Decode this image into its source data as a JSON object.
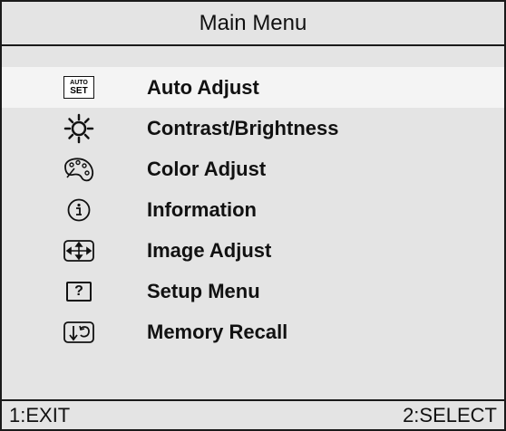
{
  "title": "Main Menu",
  "menu": {
    "items": [
      {
        "label": "Auto Adjust",
        "icon": "auto-set-icon",
        "icon_text_top": "AUTO",
        "icon_text_bottom": "SET",
        "selected": true
      },
      {
        "label": "Contrast/Brightness",
        "icon": "sun-icon"
      },
      {
        "label": "Color Adjust",
        "icon": "palette-icon"
      },
      {
        "label": "Information",
        "icon": "info-icon"
      },
      {
        "label": "Image Adjust",
        "icon": "move-arrows-icon"
      },
      {
        "label": "Setup Menu",
        "icon": "help-icon",
        "icon_text": "?"
      },
      {
        "label": "Memory Recall",
        "icon": "recall-icon"
      }
    ]
  },
  "footer": {
    "left": "1:EXIT",
    "right": "2:SELECT"
  },
  "colors": {
    "background": "#e4e4e4",
    "selected_row": "#f4f4f4",
    "text": "#111111"
  }
}
